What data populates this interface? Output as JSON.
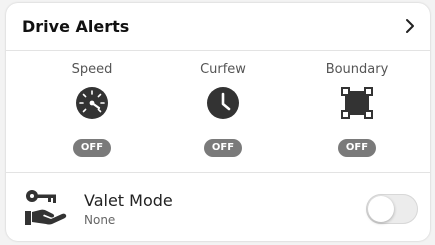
{
  "header": {
    "title": "Drive Alerts",
    "chevron_icon": "chevron-right-icon"
  },
  "alerts": [
    {
      "label": "Speed",
      "icon": "speedometer-icon",
      "status": "OFF"
    },
    {
      "label": "Curfew",
      "icon": "clock-icon",
      "status": "OFF"
    },
    {
      "label": "Boundary",
      "icon": "boundary-square-icon",
      "status": "OFF"
    }
  ],
  "valet": {
    "title": "Valet Mode",
    "subtitle": "None",
    "icon": "key-hand-icon",
    "enabled": false
  },
  "colors": {
    "pill_bg": "#7a7a7a",
    "icon_dark": "#333333",
    "toggle_off_bg": "#ececec"
  }
}
